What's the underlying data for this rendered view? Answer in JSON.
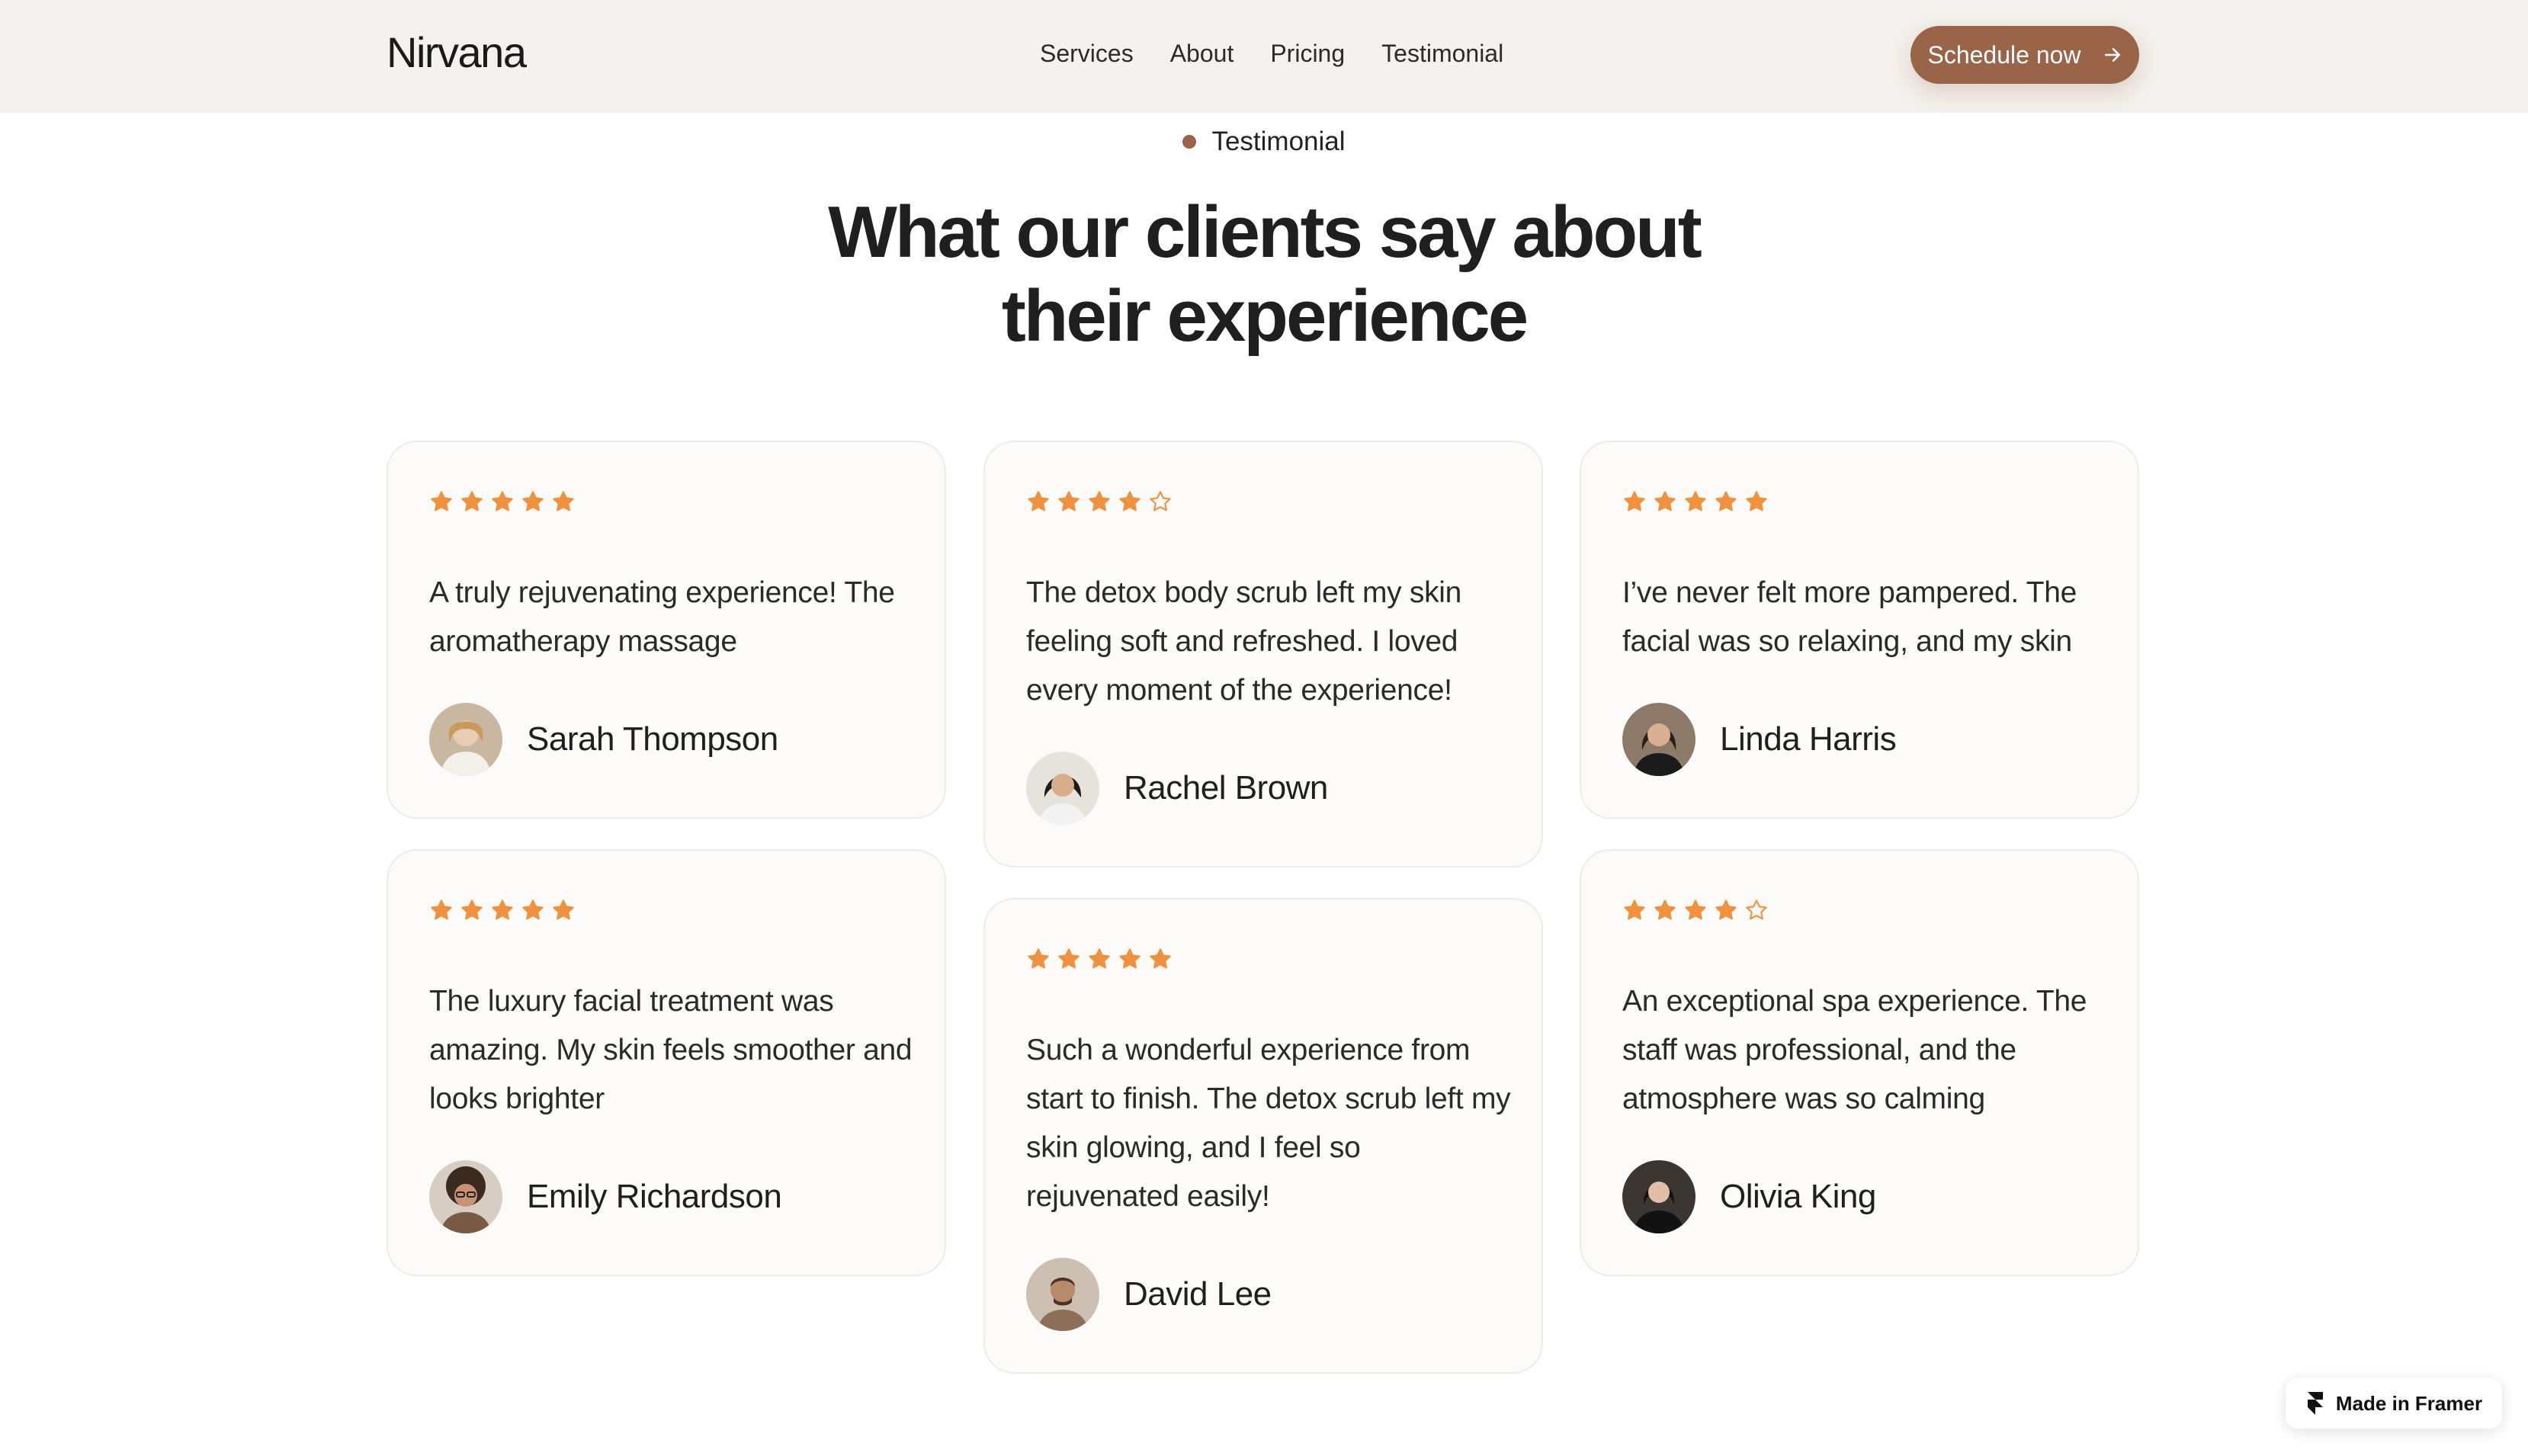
{
  "nav": {
    "logo": "Nirvana",
    "links": [
      "Services",
      "About",
      "Pricing",
      "Testimonial"
    ],
    "cta_label": "Schedule now"
  },
  "section": {
    "eyebrow": "Testimonial",
    "heading_line1": "What our clients say about",
    "heading_line2": "their experience"
  },
  "colors": {
    "accent": "#9a6448",
    "star": "#f0913f",
    "card_bg": "#fcfbf9",
    "nav_bg": "#f4f1ee"
  },
  "testimonials": [
    {
      "rating": 5,
      "quote": "A truly rejuvenating experience! The aromatherapy massage",
      "name": "Sarah Thompson"
    },
    {
      "rating": 4,
      "quote": "The detox body scrub left my skin feeling soft and refreshed. I loved every moment of the experience!",
      "name": "Rachel Brown"
    },
    {
      "rating": 5,
      "quote": "I’ve never felt more pampered. The facial was so relaxing, and my skin",
      "name": "Linda Harris"
    },
    {
      "rating": 5,
      "quote": "The luxury facial treatment was amazing. My skin feels smoother and looks brighter",
      "name": "Emily Richardson"
    },
    {
      "rating": 5,
      "quote": "Such a wonderful experience from start to finish. The detox scrub left my skin glowing, and I feel so rejuvenated easily!",
      "name": "David Lee"
    },
    {
      "rating": 4,
      "quote": "An exceptional spa experience. The staff was professional, and the atmosphere was so calming",
      "name": "Olivia King"
    }
  ],
  "badge": {
    "label": "Made in Framer",
    "icon": "framer-logo-icon"
  },
  "icons": {
    "cta": "arrow-right-icon",
    "star_filled": "star-filled-icon",
    "star_empty": "star-outline-icon"
  }
}
